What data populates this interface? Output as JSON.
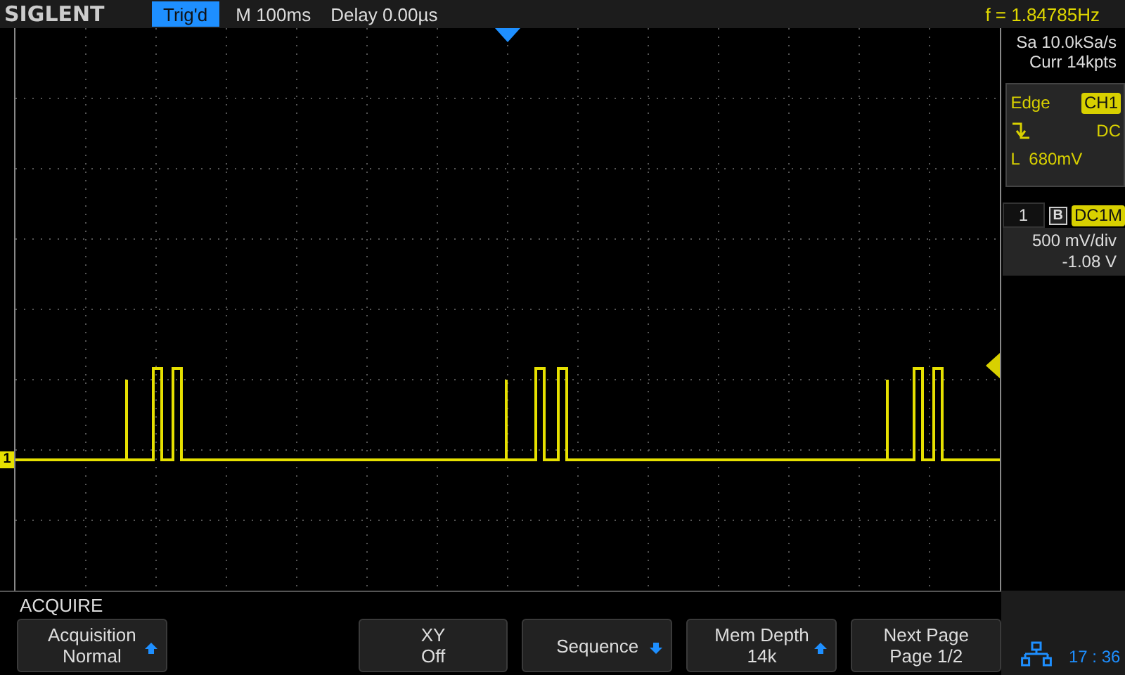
{
  "header": {
    "logo": "SIGLENT",
    "trigger_status": "Trig'd",
    "timebase": "M 100ms",
    "delay": "Delay 0.00µs",
    "frequency": "f = 1.84785Hz"
  },
  "channel_marker": "1",
  "acquisition": {
    "sample_rate": "Sa 10.0kSa/s",
    "memory": "Curr 14kpts"
  },
  "trigger": {
    "type": "Edge",
    "source": "CH1",
    "coupling": "DC",
    "level": "L  680mV"
  },
  "channel": {
    "number": "1",
    "bandwidth_limit": "B",
    "coupling": "DC1M",
    "scale": "500 mV/div",
    "offset": "-1.08 V"
  },
  "menu": {
    "title": "ACQUIRE",
    "softkeys": [
      {
        "kind": "up",
        "label": "Acquisition",
        "value": "Normal"
      },
      {
        "kind": "empty"
      },
      {
        "kind": "plain",
        "label": "XY",
        "value": "Off"
      },
      {
        "kind": "down",
        "label": "Sequence"
      },
      {
        "kind": "up",
        "label": "Mem Depth",
        "value": "14k"
      },
      {
        "kind": "plain",
        "label": "Next Page",
        "value": "Page 1/2"
      }
    ]
  },
  "status": {
    "time": "17 : 36"
  }
}
